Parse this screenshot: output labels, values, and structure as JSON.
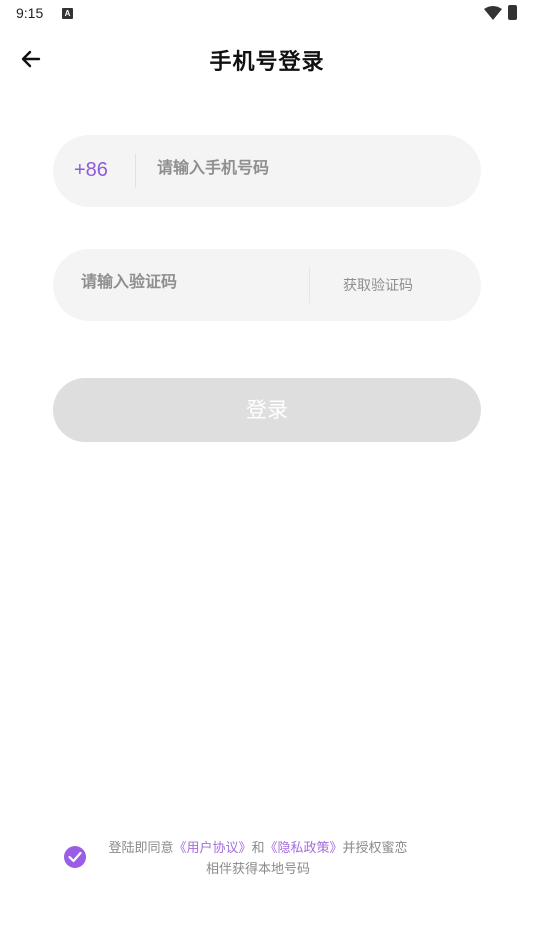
{
  "status_bar": {
    "time": "9:15",
    "notification_letter": "A"
  },
  "header": {
    "title": "手机号登录"
  },
  "phone_field": {
    "country_code": "+86",
    "placeholder": "请输入手机号码",
    "value": ""
  },
  "code_field": {
    "placeholder": "请输入验证码",
    "value": "",
    "get_code_label": "获取验证码"
  },
  "login_button": {
    "label": "登录",
    "enabled": false
  },
  "agreement": {
    "checked": true,
    "prefix": "登陆即同意",
    "user_agreement": "《用户协议》",
    "and": "和",
    "privacy_policy": "《隐私政策》",
    "suffix_line1": "并授权蜜恋",
    "suffix_line2": "相伴获得本地号码"
  },
  "colors": {
    "accent": "#9b5de5",
    "link": "#a46ee0",
    "field_bg": "#f4f4f4",
    "button_disabled": "#dedede"
  },
  "icons": {
    "back": "arrow-left-icon",
    "check": "check-icon",
    "wifi": "wifi-icon",
    "battery": "battery-icon"
  }
}
